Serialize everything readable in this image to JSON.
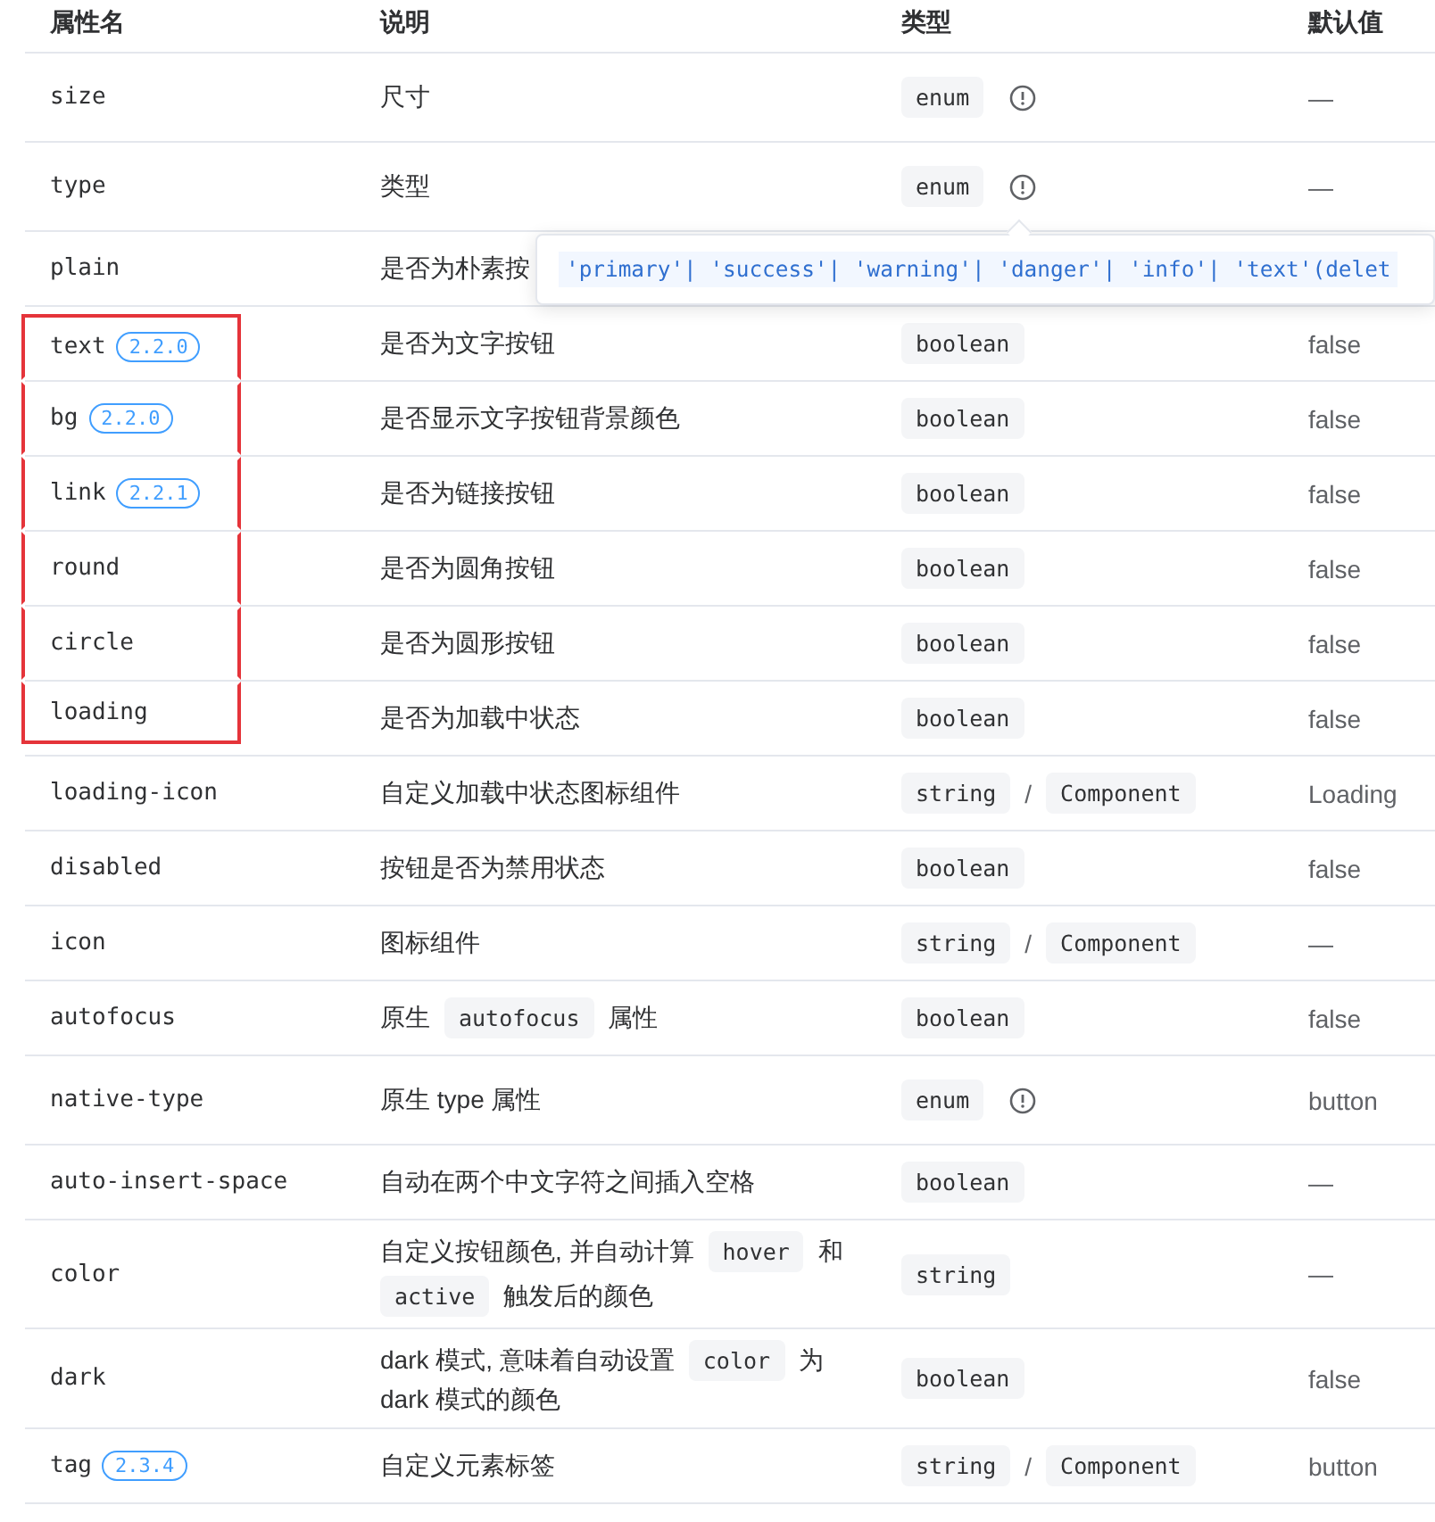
{
  "table": {
    "columns": [
      "属性名",
      "说明",
      "类型",
      "默认值"
    ],
    "rows": [
      {
        "name": "size",
        "desc": [
          {
            "kind": "text",
            "text": "尺寸"
          }
        ],
        "type": [
          {
            "kind": "code",
            "text": "enum"
          },
          {
            "kind": "info"
          }
        ],
        "default": "—",
        "highlighted": false
      },
      {
        "name": "type",
        "desc": [
          {
            "kind": "text",
            "text": "类型"
          }
        ],
        "type": [
          {
            "kind": "code",
            "text": "enum"
          },
          {
            "kind": "info"
          }
        ],
        "default": "—",
        "highlighted": false
      },
      {
        "name": "plain",
        "desc": [
          {
            "kind": "text",
            "text": "是否为朴素按"
          }
        ],
        "highlighted": false
      },
      {
        "name": "text",
        "version": "2.2.0",
        "desc": [
          {
            "kind": "text",
            "text": "是否为文字按钮"
          }
        ],
        "type": [
          {
            "kind": "code",
            "text": "boolean"
          }
        ],
        "default": "false",
        "highlighted": true
      },
      {
        "name": "bg",
        "version": "2.2.0",
        "desc": [
          {
            "kind": "text",
            "text": "是否显示文字按钮背景颜色"
          }
        ],
        "type": [
          {
            "kind": "code",
            "text": "boolean"
          }
        ],
        "default": "false",
        "highlighted": true
      },
      {
        "name": "link",
        "version": "2.2.1",
        "desc": [
          {
            "kind": "text",
            "text": "是否为链接按钮"
          }
        ],
        "type": [
          {
            "kind": "code",
            "text": "boolean"
          }
        ],
        "default": "false",
        "highlighted": true
      },
      {
        "name": "round",
        "desc": [
          {
            "kind": "text",
            "text": "是否为圆角按钮"
          }
        ],
        "type": [
          {
            "kind": "code",
            "text": "boolean"
          }
        ],
        "default": "false",
        "highlighted": true
      },
      {
        "name": "circle",
        "desc": [
          {
            "kind": "text",
            "text": "是否为圆形按钮"
          }
        ],
        "type": [
          {
            "kind": "code",
            "text": "boolean"
          }
        ],
        "default": "false",
        "highlighted": true
      },
      {
        "name": "loading",
        "desc": [
          {
            "kind": "text",
            "text": "是否为加载中状态"
          }
        ],
        "type": [
          {
            "kind": "code",
            "text": "boolean"
          }
        ],
        "default": "false",
        "highlighted": true
      },
      {
        "name": "loading-icon",
        "desc": [
          {
            "kind": "text",
            "text": "自定义加载中状态图标组件"
          }
        ],
        "type": [
          {
            "kind": "code",
            "text": "string"
          },
          {
            "kind": "sep",
            "text": "/"
          },
          {
            "kind": "code",
            "text": "Component"
          }
        ],
        "default": "Loading",
        "highlighted": false
      },
      {
        "name": "disabled",
        "desc": [
          {
            "kind": "text",
            "text": "按钮是否为禁用状态"
          }
        ],
        "type": [
          {
            "kind": "code",
            "text": "boolean"
          }
        ],
        "default": "false",
        "highlighted": false
      },
      {
        "name": "icon",
        "desc": [
          {
            "kind": "text",
            "text": "图标组件"
          }
        ],
        "type": [
          {
            "kind": "code",
            "text": "string"
          },
          {
            "kind": "sep",
            "text": "/"
          },
          {
            "kind": "code",
            "text": "Component"
          }
        ],
        "default": "—",
        "highlighted": false
      },
      {
        "name": "autofocus",
        "desc": [
          {
            "kind": "text",
            "text": "原生"
          },
          {
            "kind": "code",
            "text": "autofocus"
          },
          {
            "kind": "text",
            "text": "属性"
          }
        ],
        "type": [
          {
            "kind": "code",
            "text": "boolean"
          }
        ],
        "default": "false",
        "highlighted": false
      },
      {
        "name": "native-type",
        "desc": [
          {
            "kind": "text",
            "text": "原生 type 属性"
          }
        ],
        "type": [
          {
            "kind": "code",
            "text": "enum"
          },
          {
            "kind": "info"
          }
        ],
        "default": "button",
        "highlighted": false
      },
      {
        "name": "auto-insert-space",
        "desc": [
          {
            "kind": "text",
            "text": "自动在两个中文字符之间插入空格"
          }
        ],
        "type": [
          {
            "kind": "code",
            "text": "boolean"
          }
        ],
        "default": "—",
        "highlighted": false
      },
      {
        "name": "color",
        "desc": [
          {
            "kind": "text",
            "text": "自定义按钮颜色, 并自动计算"
          },
          {
            "kind": "code",
            "text": "hover"
          },
          {
            "kind": "text",
            "text": "和"
          },
          {
            "kind": "code",
            "text": "active"
          },
          {
            "kind": "text",
            "text": "触发后的颜色"
          }
        ],
        "type": [
          {
            "kind": "code",
            "text": "string"
          }
        ],
        "default": "—",
        "highlighted": false
      },
      {
        "name": "dark",
        "desc": [
          {
            "kind": "text",
            "text": "dark 模式, 意味着自动设置"
          },
          {
            "kind": "code",
            "text": "color"
          },
          {
            "kind": "text",
            "text": "为"
          },
          {
            "kind": "text",
            "text": "dark 模式的颜色"
          }
        ],
        "type": [
          {
            "kind": "code",
            "text": "boolean"
          }
        ],
        "default": "false",
        "highlighted": false
      },
      {
        "name": "tag",
        "version": "2.3.4",
        "desc": [
          {
            "kind": "text",
            "text": "自定义元素标签"
          }
        ],
        "type": [
          {
            "kind": "code",
            "text": "string"
          },
          {
            "kind": "sep",
            "text": "/"
          },
          {
            "kind": "code",
            "text": "Component"
          }
        ],
        "default": "button",
        "highlighted": false
      }
    ],
    "tooltip": {
      "text": "'primary'| 'success'| 'warning'| 'danger'| 'info'| 'text'(delet"
    }
  }
}
